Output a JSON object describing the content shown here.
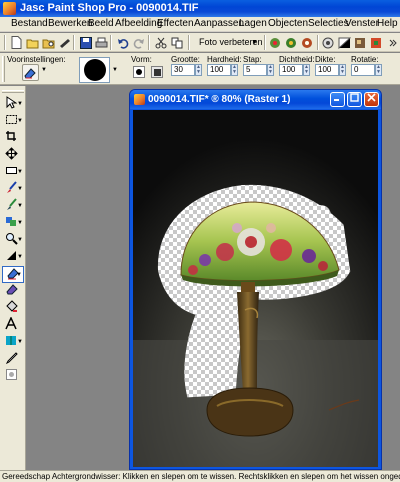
{
  "app": {
    "title": "Jasc Paint Shop Pro - 0090014.TIF"
  },
  "menu": [
    "Bestand",
    "Bewerken",
    "Beeld",
    "Afbeelding",
    "Effecten",
    "Aanpassen",
    "Lagen",
    "Objecten",
    "Selecties",
    "Venster",
    "Help"
  ],
  "toolbar": {
    "photo_fix_label": "Foto verbeteren"
  },
  "options": {
    "presets_label": "Voorinstellingen:",
    "shape_label": "Vorm:",
    "size_label": "Grootte:",
    "size_value": "30",
    "hardness_label": "Hardheid:",
    "hardness_value": "100",
    "step_label": "Stap:",
    "step_value": "5",
    "density_label": "Dichtheid:",
    "density_value": "100",
    "thickness_label": "Dikte:",
    "thickness_value": "100",
    "rotation_label": "Rotatie:",
    "rotation_value": "0"
  },
  "tools": [
    {
      "name": "pan-tool",
      "icon": "arrow-icon"
    },
    {
      "name": "selection-tool",
      "icon": "selection-icon"
    },
    {
      "name": "crop-tool",
      "icon": "crop-icon"
    },
    {
      "name": "move-tool",
      "icon": "move-icon"
    },
    {
      "name": "preset-shape-tool",
      "icon": "rectangle-icon"
    },
    {
      "name": "paint-brush-tool",
      "icon": "brush-icon"
    },
    {
      "name": "clone-brush-tool",
      "icon": "clone-icon"
    },
    {
      "name": "replace-color-tool",
      "icon": "replace-icon"
    },
    {
      "name": "zoom-tool",
      "icon": "magnifier-icon"
    },
    {
      "name": "dodge-tool",
      "icon": "dodge-icon"
    },
    {
      "name": "background-eraser-tool",
      "icon": "eraser-icon"
    },
    {
      "name": "eraser-tool",
      "icon": "eraser-icon"
    },
    {
      "name": "fill-tool",
      "icon": "bucket-icon"
    },
    {
      "name": "text-tool",
      "icon": "text-icon"
    },
    {
      "name": "pen-tool",
      "icon": "pen-icon"
    },
    {
      "name": "dropper-tool",
      "icon": "dropper-icon"
    },
    {
      "name": "picture-tube-tool",
      "icon": "tube-icon"
    }
  ],
  "document": {
    "title": "0090014.TIF* ®  80% (Raster 1)"
  },
  "status": "Gereedschap Achtergrondwisser: Klikken en slepen om te wissen. Rechtsklikken en slepen om het wissen ongedaan te maken. Sh",
  "colors": {
    "xp_blue": "#0a49d6",
    "panel": "#ece9d8",
    "workspace": "#848484",
    "canvas_bg": "#101010"
  }
}
